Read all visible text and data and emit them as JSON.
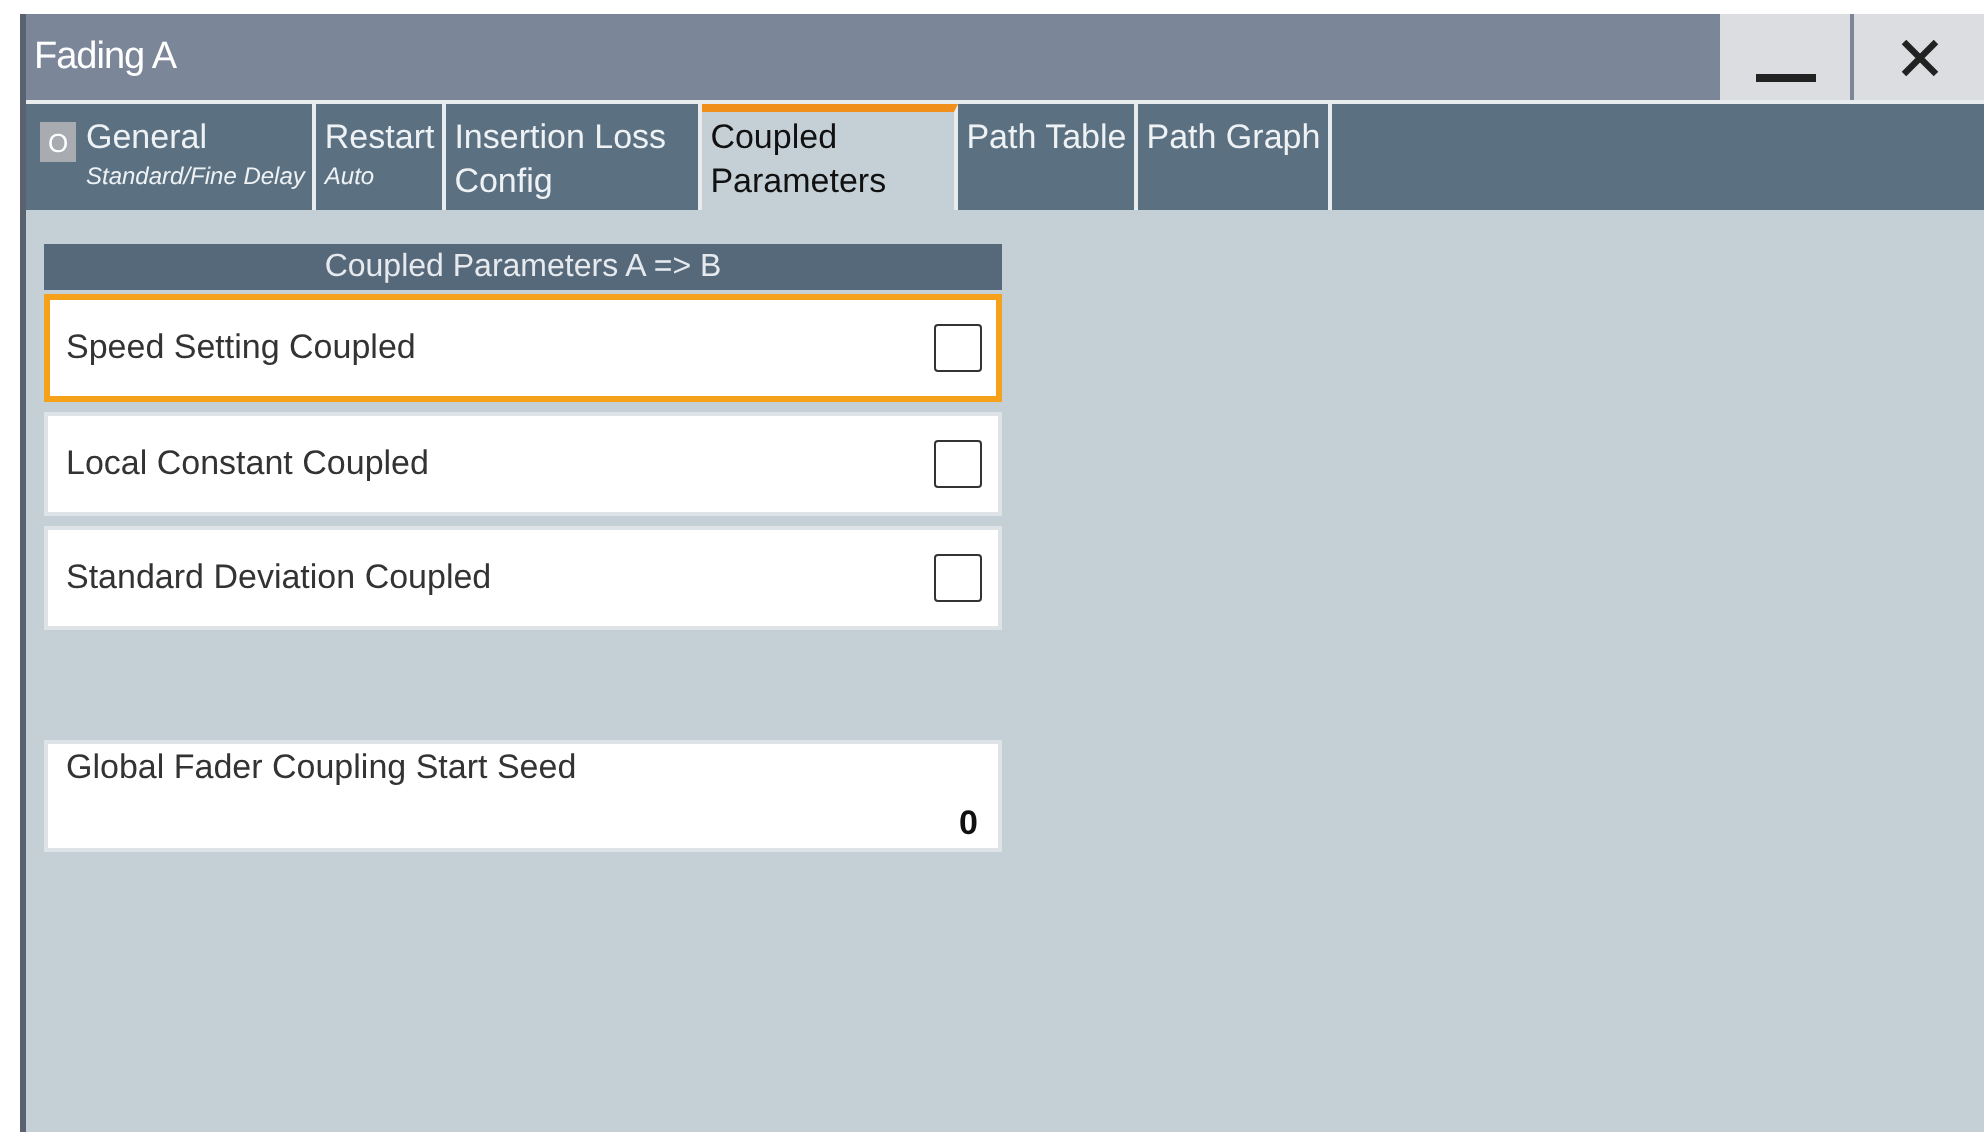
{
  "window": {
    "title": "Fading A"
  },
  "tabs": [
    {
      "label": "General",
      "subtitle": "Standard/Fine Delay",
      "state_label": "O",
      "selected": false
    },
    {
      "label": "Restart",
      "subtitle": "Auto",
      "selected": false
    },
    {
      "label": "Insertion Loss Config",
      "selected": false
    },
    {
      "label": "Coupled Parameters",
      "selected": true
    },
    {
      "label": "Path Table",
      "selected": false
    },
    {
      "label": "Path Graph",
      "selected": false
    }
  ],
  "panel": {
    "header": "Coupled Parameters A => B",
    "rows": [
      {
        "label": "Speed Setting Coupled",
        "checked": false,
        "focused": true
      },
      {
        "label": "Local Constant Coupled",
        "checked": false,
        "focused": false
      },
      {
        "label": "Standard Deviation Coupled",
        "checked": false,
        "focused": false
      }
    ],
    "seed": {
      "label": "Global Fader Coupling Start Seed",
      "value": "0"
    }
  }
}
